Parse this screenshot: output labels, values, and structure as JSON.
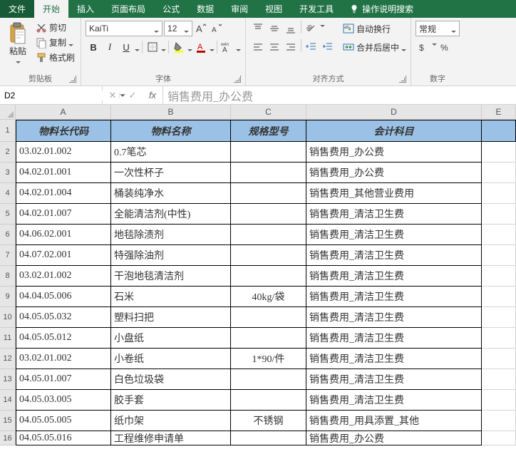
{
  "tabs": {
    "file": "文件",
    "home": "开始",
    "insert": "插入",
    "page_layout": "页面布局",
    "formulas": "公式",
    "data": "数据",
    "review": "审阅",
    "view": "视图",
    "developer": "开发工具",
    "tell_me": "操作说明搜索"
  },
  "ribbon": {
    "clipboard": {
      "paste": "粘贴",
      "cut": "剪切",
      "copy": "复制",
      "format_painter": "格式刷",
      "title": "剪贴板"
    },
    "font": {
      "name": "KaiTi",
      "size": "12",
      "title": "字体"
    },
    "alignment": {
      "wrap": "自动换行",
      "merge": "合并后居中",
      "title": "对齐方式"
    },
    "number": {
      "format": "常规",
      "title": "数字"
    }
  },
  "formula_bar": {
    "cell_ref": "D2",
    "value": "销售费用_办公费"
  },
  "columns": [
    "A",
    "B",
    "C",
    "D",
    "E"
  ],
  "row_numbers": [
    "1",
    "2",
    "3",
    "4",
    "5",
    "6",
    "7",
    "8",
    "9",
    "10",
    "11",
    "12",
    "13",
    "14",
    "15",
    "16"
  ],
  "headers": {
    "a": "物料长代码",
    "b": "物料名称",
    "c": "规格型号",
    "d": "会计科目"
  },
  "rows": [
    {
      "a": "03.02.01.002",
      "b": "0.7笔芯",
      "c": "",
      "d": "销售费用_办公费"
    },
    {
      "a": "04.02.01.001",
      "b": "一次性杯子",
      "c": "",
      "d": "销售费用_办公费"
    },
    {
      "a": "04.02.01.004",
      "b": "桶装纯净水",
      "c": "",
      "d": "销售费用_其他营业费用"
    },
    {
      "a": "04.02.01.007",
      "b": "全能清洁剂(中性)",
      "c": "",
      "d": "销售费用_清洁卫生费"
    },
    {
      "a": "04.06.02.001",
      "b": "地毯除渍剂",
      "c": "",
      "d": "销售费用_清洁卫生费"
    },
    {
      "a": "04.07.02.001",
      "b": "特强除油剂",
      "c": "",
      "d": "销售费用_清洁卫生费"
    },
    {
      "a": "03.02.01.002",
      "b": "干泡地毯清洁剂",
      "c": "",
      "d": "销售费用_清洁卫生费"
    },
    {
      "a": "04.04.05.006",
      "b": "石米",
      "c": "40kg/袋",
      "d": "销售费用_清洁卫生费"
    },
    {
      "a": "04.05.05.032",
      "b": "塑料扫把",
      "c": "",
      "d": "销售费用_清洁卫生费"
    },
    {
      "a": "04.05.05.012",
      "b": "小盘纸",
      "c": "",
      "d": "销售费用_清洁卫生费"
    },
    {
      "a": "03.02.01.002",
      "b": "小卷纸",
      "c": "1*90/件",
      "d": "销售费用_清洁卫生费"
    },
    {
      "a": "04.05.01.007",
      "b": "白色垃圾袋",
      "c": "",
      "d": "销售费用_清洁卫生费"
    },
    {
      "a": "04.05.03.005",
      "b": "胶手套",
      "c": "",
      "d": "销售费用_清洁卫生费"
    },
    {
      "a": "04.05.05.005",
      "b": "纸巾架",
      "c": "不锈钢",
      "d": "销售费用_用具添置_其他"
    },
    {
      "a": "04.05.05.016",
      "b": "工程维修申请单",
      "c": "",
      "d": "销售费用_办公费"
    }
  ]
}
